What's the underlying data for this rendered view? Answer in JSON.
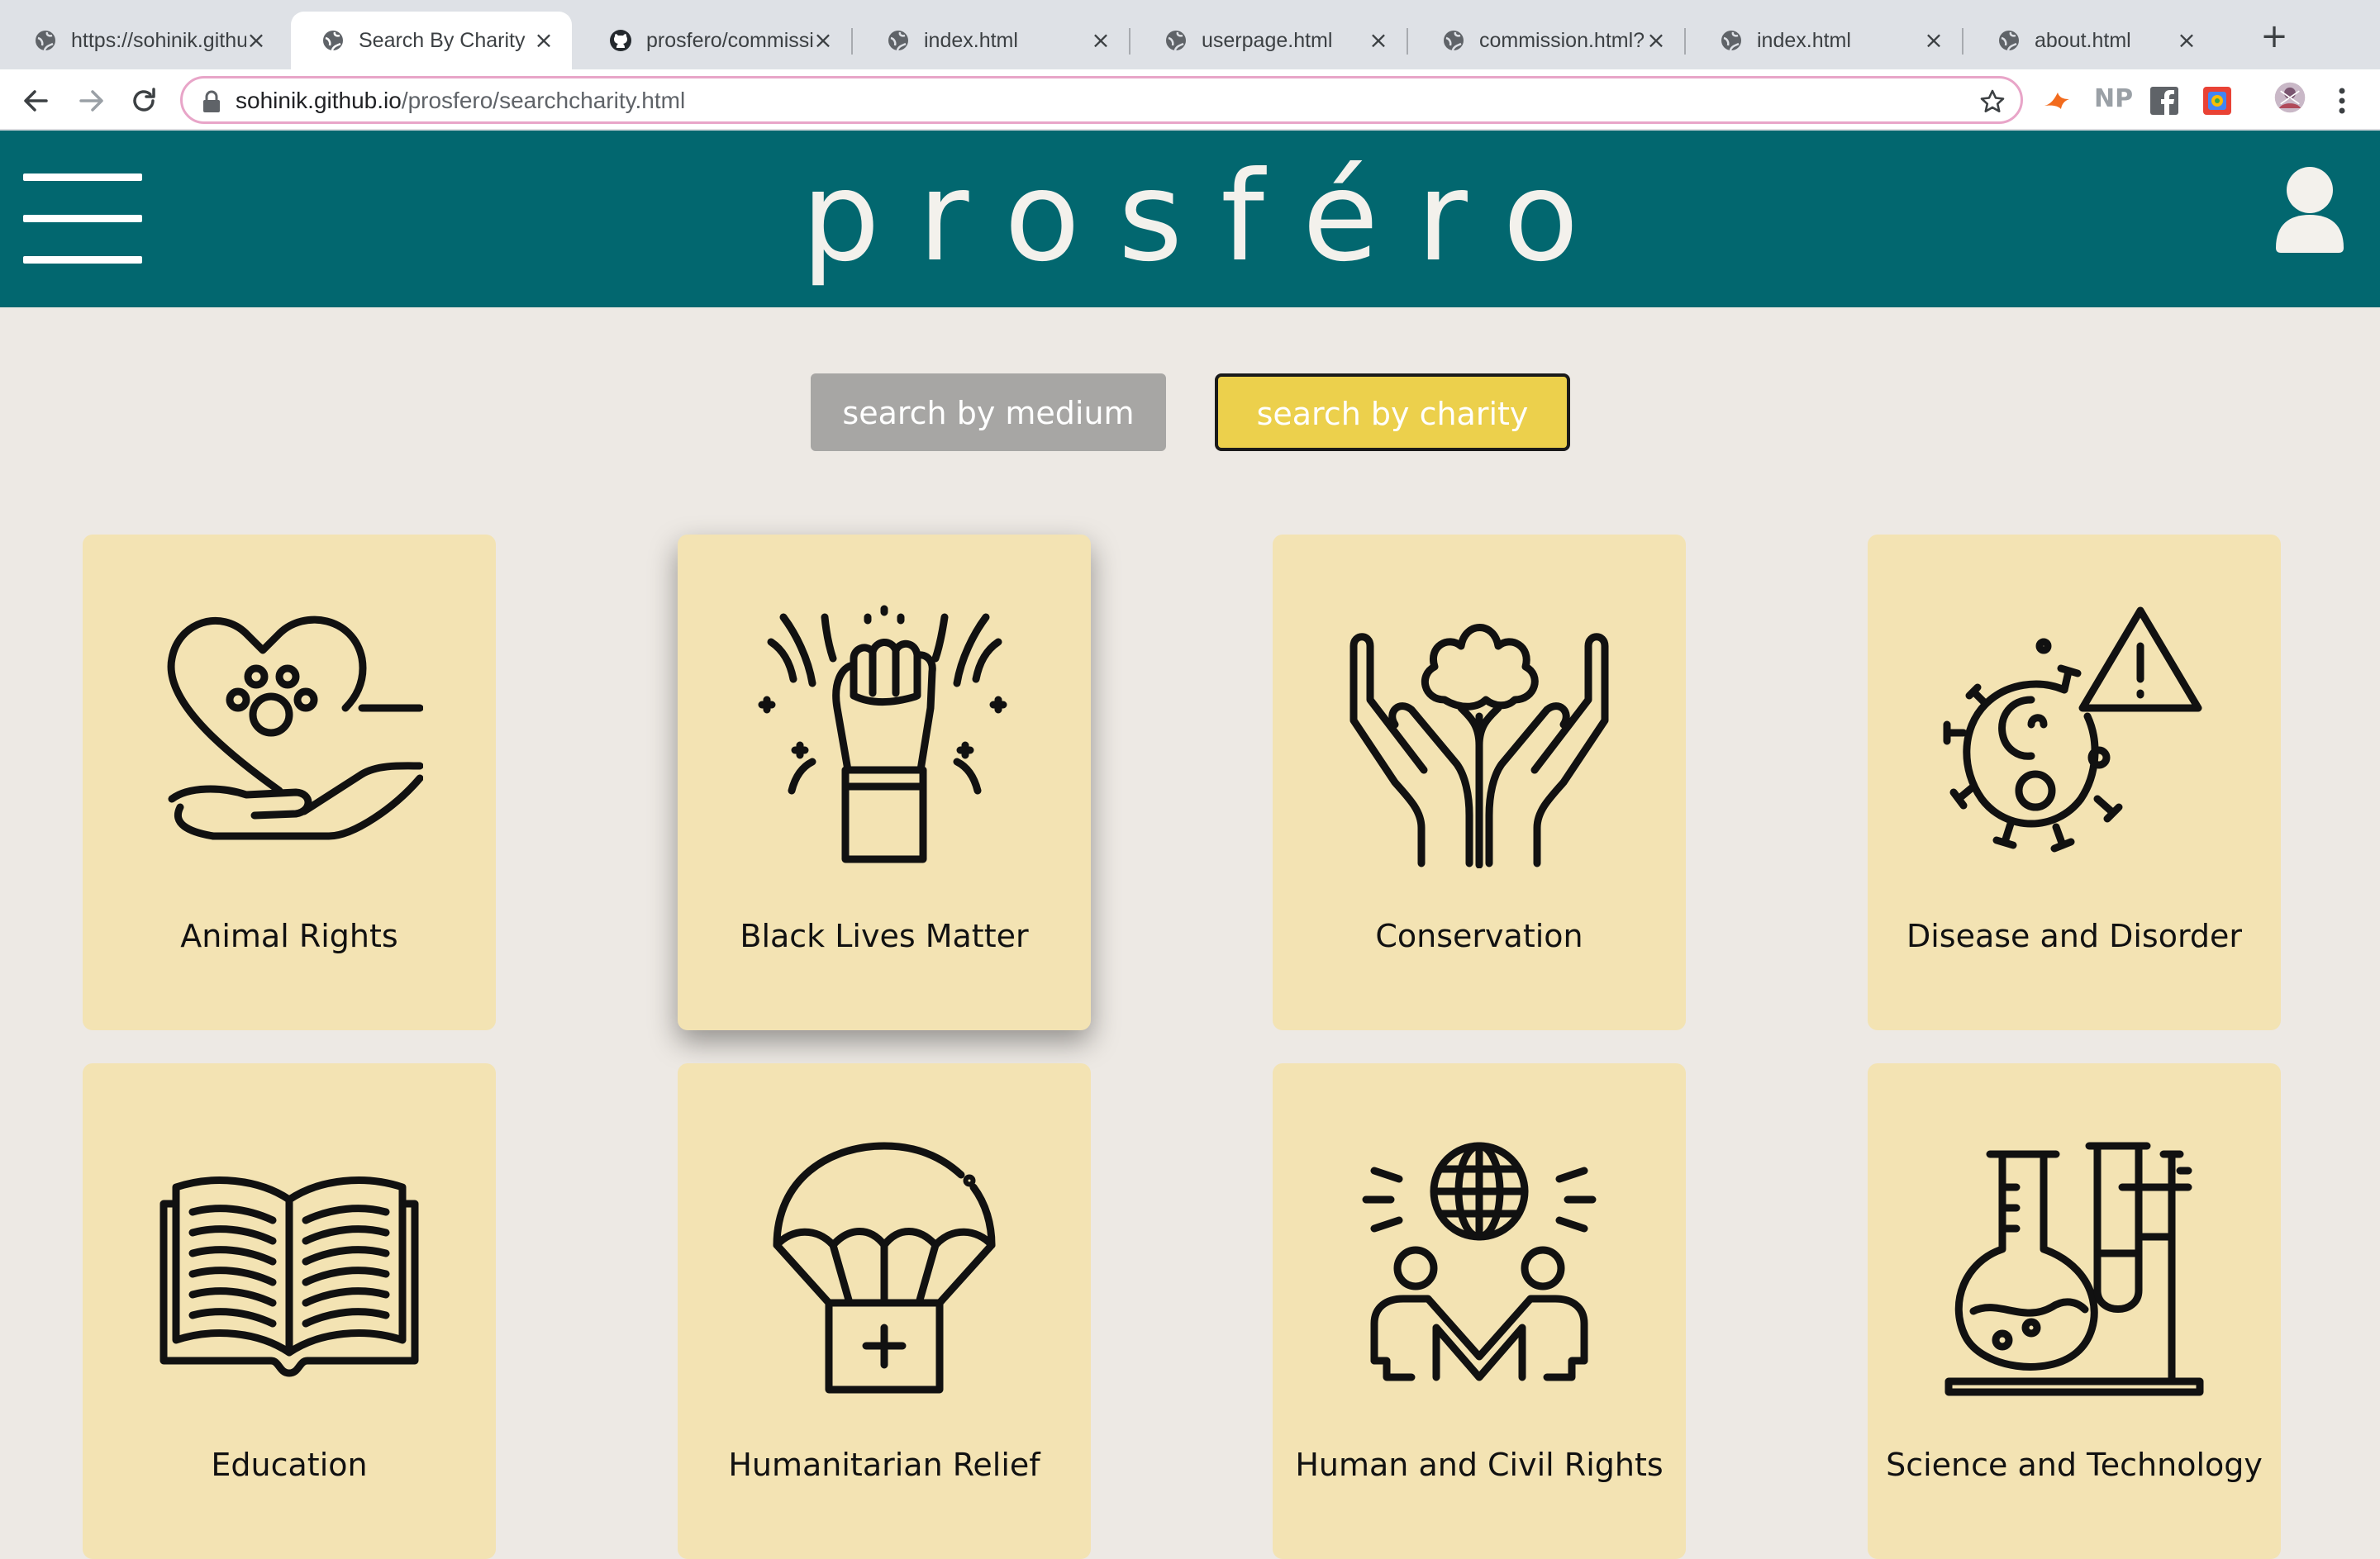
{
  "browser": {
    "tabs": [
      {
        "title": "https://sohinik.github.io",
        "favicon": "globe-icon"
      },
      {
        "title": "Search By Charity",
        "favicon": "globe-icon",
        "active": true
      },
      {
        "title": "prosfero/commission",
        "favicon": "github-icon"
      },
      {
        "title": "index.html",
        "favicon": "globe-icon"
      },
      {
        "title": "userpage.html",
        "favicon": "globe-icon"
      },
      {
        "title": "commission.html?",
        "favicon": "globe-icon"
      },
      {
        "title": "index.html",
        "favicon": "globe-icon"
      },
      {
        "title": "about.html",
        "favicon": "globe-icon"
      }
    ],
    "url_host": "sohinik.github.io",
    "url_path": "/prosfero/searchcharity.html",
    "extensions": [
      "bird-extension-icon",
      "np-extension-icon",
      "facebook-icon",
      "colorful-extension-icon",
      "profile-avatar-icon",
      "more-menu-icon"
    ],
    "np_label": "NP"
  },
  "site": {
    "logo": "prosféro",
    "colors": {
      "header": "#02676f",
      "background": "#ede9e4",
      "card": "#f3e3b3",
      "active_button": "#ecd04c",
      "inactive_button": "#a7a6a4"
    }
  },
  "toggle": {
    "medium_label": "search by medium",
    "charity_label": "search by charity",
    "active": "charity"
  },
  "charities": [
    {
      "label": "Animal Rights",
      "icon": "heart-paw-hand-icon"
    },
    {
      "label": "Black Lives Matter",
      "icon": "raised-fist-icon"
    },
    {
      "label": "Conservation",
      "icon": "hands-tree-icon"
    },
    {
      "label": "Disease and Disorder",
      "icon": "virus-warning-icon"
    },
    {
      "label": "Education",
      "icon": "open-book-icon"
    },
    {
      "label": "Humanitarian Relief",
      "icon": "aid-parachute-icon"
    },
    {
      "label": "Human and Civil Rights",
      "icon": "people-globe-icon"
    },
    {
      "label": "Science and Technology",
      "icon": "flask-test-tube-icon"
    }
  ]
}
